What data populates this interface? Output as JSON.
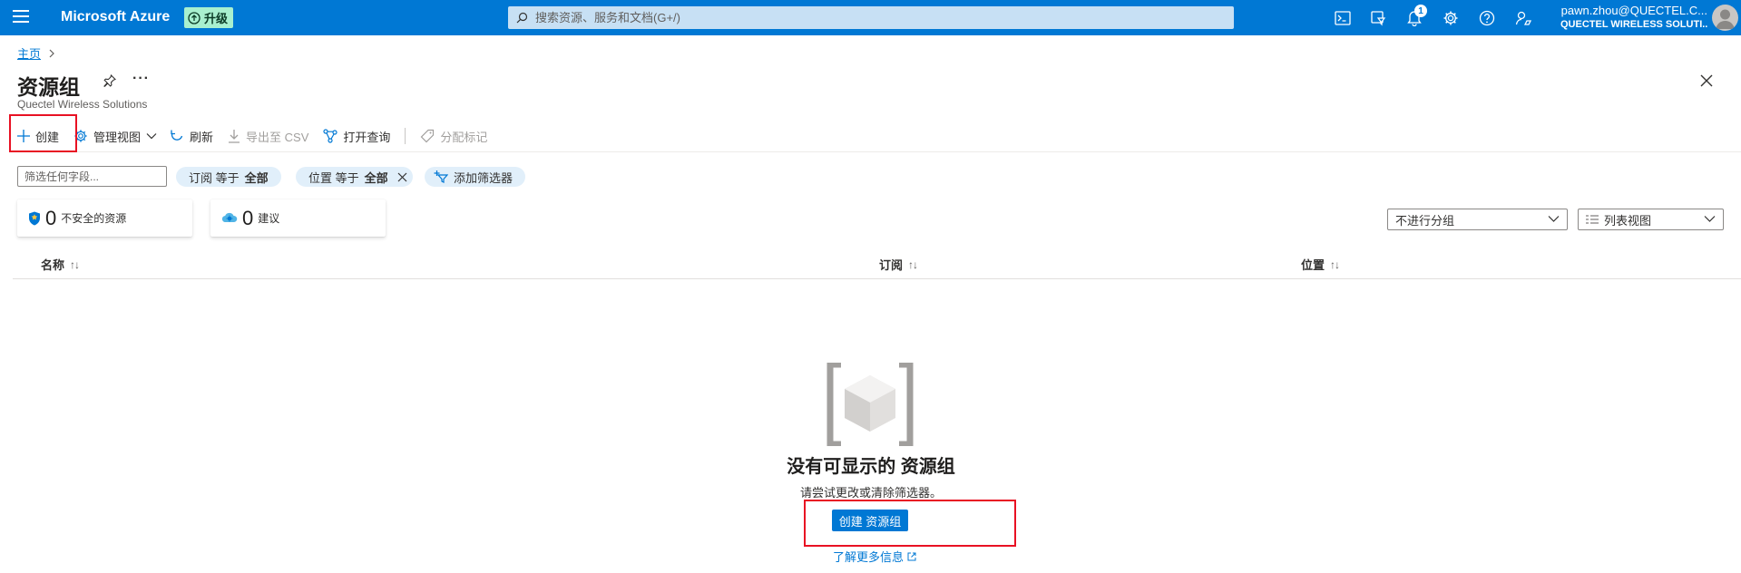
{
  "topbar": {
    "brand": "Microsoft Azure",
    "upgrade_label": "升级",
    "search_placeholder": "搜索资源、服务和文档(G+/)",
    "notification_count": "1",
    "account_user": "pawn.zhou@QUECTEL.C...",
    "account_tenant": "QUECTEL WIRELESS SOLUTI...",
    "color": "#0078d4",
    "icons": [
      "hamburger-icon",
      "upgrade-icon",
      "search-icon",
      "cloud-shell-icon",
      "directory-filter-icon",
      "notifications-icon",
      "settings-icon",
      "help-icon",
      "feedback-icon",
      "avatar"
    ]
  },
  "breadcrumb": {
    "home": "主页"
  },
  "header": {
    "title": "资源组",
    "subtitle": "Quectel Wireless Solutions"
  },
  "toolbar": {
    "create": "创建",
    "manage_view": "管理视图",
    "refresh": "刷新",
    "export_csv": "导出至 CSV",
    "open_query": "打开查询",
    "assign_tags": "分配标记"
  },
  "filters": {
    "input_placeholder": "筛选任何字段...",
    "subscription_key": "订阅 等于",
    "subscription_value": "全部",
    "location_key": "位置 等于",
    "location_value": "全部",
    "add_filter": "添加筛选器"
  },
  "cards": {
    "insecure_count": "0",
    "insecure_label": "不安全的资源",
    "recommend_count": "0",
    "recommend_label": "建议"
  },
  "dropdowns": {
    "grouping": "不进行分组",
    "view": "列表视图"
  },
  "table": {
    "columns": [
      "名称",
      "订阅",
      "位置"
    ],
    "sort_glyph": "↑↓"
  },
  "empty_state": {
    "title": "没有可显示的 资源组",
    "description": "请尝试更改或清除筛选器。",
    "create_button": "创建 资源组",
    "learn_more": "了解更多信息"
  },
  "accent_color": "#0078d4",
  "highlight_color": "#e81123"
}
